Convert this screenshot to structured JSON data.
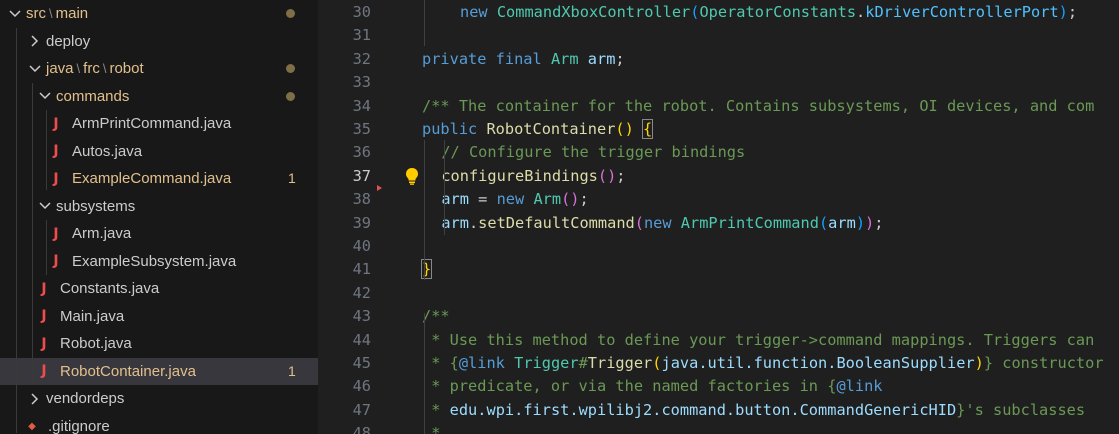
{
  "explorer": {
    "items": [
      {
        "label_parts": [
          "src",
          "main"
        ],
        "depth": 0,
        "chevron": "down",
        "status": "dot"
      },
      {
        "label": "deploy",
        "depth": 1,
        "chevron": "right"
      },
      {
        "label_parts": [
          "java",
          "frc",
          "robot"
        ],
        "depth": 1,
        "chevron": "down",
        "status": "dot"
      },
      {
        "label": "commands",
        "depth": 2,
        "chevron": "down",
        "status": "dot"
      },
      {
        "label": "ArmPrintCommand.java",
        "depth": 3,
        "icon": "java-file-icon"
      },
      {
        "label": "Autos.java",
        "depth": 3,
        "icon": "java-file-icon"
      },
      {
        "label": "ExampleCommand.java",
        "depth": 3,
        "icon": "java-file-icon",
        "badge": "1"
      },
      {
        "label": "subsystems",
        "depth": 2,
        "chevron": "down"
      },
      {
        "label": "Arm.java",
        "depth": 3,
        "icon": "java-file-icon"
      },
      {
        "label": "ExampleSubsystem.java",
        "depth": 3,
        "icon": "java-file-icon"
      },
      {
        "label": "Constants.java",
        "depth": 2,
        "icon": "java-file-icon"
      },
      {
        "label": "Main.java",
        "depth": 2,
        "icon": "java-file-icon"
      },
      {
        "label": "Robot.java",
        "depth": 2,
        "icon": "java-file-icon"
      },
      {
        "label": "RobotContainer.java",
        "depth": 2,
        "icon": "java-file-icon",
        "badge": "1",
        "selected": true
      },
      {
        "label": "vendordeps",
        "depth": 1,
        "chevron": "right"
      },
      {
        "label": ".gitignore",
        "depth": 1,
        "icon": "gitignore-icon"
      }
    ],
    "path_separator": "\\"
  },
  "editor": {
    "active_line": 37,
    "lines": [
      {
        "n": 30,
        "indent": 1,
        "tokens": [
          [
            "kw",
            "new "
          ],
          [
            "ty",
            "CommandXboxController"
          ],
          [
            "br3",
            "("
          ],
          [
            "ty",
            "OperatorConstants"
          ],
          [
            "p",
            "."
          ],
          [
            "cl",
            "kDriverControllerPort"
          ],
          [
            "br3",
            ")"
          ],
          [
            "p",
            ";"
          ]
        ]
      },
      {
        "n": 31,
        "indent": 0,
        "tokens": []
      },
      {
        "n": 32,
        "indent": 0,
        "tokens": [
          [
            "kw",
            "private final "
          ],
          [
            "ty",
            "Arm "
          ],
          [
            "va",
            "arm"
          ],
          [
            "p",
            ";"
          ]
        ]
      },
      {
        "n": 33,
        "indent": 0,
        "tokens": []
      },
      {
        "n": 34,
        "indent": 0,
        "tokens": [
          [
            "co",
            "/** The container for the robot. Contains subsystems, OI devices, and com"
          ]
        ]
      },
      {
        "n": 35,
        "indent": 0,
        "tokens": [
          [
            "kw",
            "public "
          ],
          [
            "fn",
            "RobotContainer"
          ],
          [
            "br1",
            "()"
          ],
          [
            "p",
            " "
          ],
          [
            "br1box",
            "{"
          ]
        ]
      },
      {
        "n": 36,
        "indent": 1,
        "tokens": [
          [
            "co",
            "// Configure the trigger bindings"
          ]
        ]
      },
      {
        "n": 37,
        "indent": 1,
        "tokens": [
          [
            "fn",
            "configureBindings"
          ],
          [
            "br2",
            "()"
          ],
          [
            "p",
            ";"
          ]
        ]
      },
      {
        "n": 38,
        "indent": 1,
        "tokens": [
          [
            "va",
            "arm"
          ],
          [
            "p",
            " = "
          ],
          [
            "kw",
            "new "
          ],
          [
            "ty",
            "Arm"
          ],
          [
            "br2",
            "()"
          ],
          [
            "p",
            ";"
          ]
        ]
      },
      {
        "n": 39,
        "indent": 1,
        "tokens": [
          [
            "va",
            "arm"
          ],
          [
            "p",
            "."
          ],
          [
            "fn",
            "setDefaultCommand"
          ],
          [
            "br2",
            "("
          ],
          [
            "kw",
            "new "
          ],
          [
            "ty",
            "ArmPrintCommand"
          ],
          [
            "br3",
            "("
          ],
          [
            "va",
            "arm"
          ],
          [
            "br3",
            ")"
          ],
          [
            "br2",
            ")"
          ],
          [
            "p",
            ";"
          ]
        ]
      },
      {
        "n": 40,
        "indent": 0,
        "tokens": []
      },
      {
        "n": 41,
        "indent": 0,
        "tokens": [
          [
            "br1box",
            "}"
          ]
        ]
      },
      {
        "n": 42,
        "indent": 0,
        "tokens": []
      },
      {
        "n": 43,
        "indent": 0,
        "tokens": [
          [
            "co",
            "/**"
          ]
        ]
      },
      {
        "n": 44,
        "indent": 0,
        "tokens": [
          [
            "co",
            " * Use this method to define your trigger->command mappings. Triggers can"
          ]
        ]
      },
      {
        "n": 45,
        "indent": 0,
        "tokens": [
          [
            "co",
            " * {"
          ],
          [
            "tg",
            "@link "
          ],
          [
            "ty",
            "Trigger"
          ],
          [
            "co",
            "#"
          ],
          [
            "fn",
            "Trigger"
          ],
          [
            "br1",
            "("
          ],
          [
            "va",
            "java.util.function.BooleanSupplier"
          ],
          [
            "br1",
            ")"
          ],
          [
            "co",
            "} constructor"
          ]
        ]
      },
      {
        "n": 46,
        "indent": 0,
        "tokens": [
          [
            "co",
            " * predicate, or via the named factories in {"
          ],
          [
            "tg",
            "@link"
          ]
        ]
      },
      {
        "n": 47,
        "indent": 0,
        "tokens": [
          [
            "co",
            " * "
          ],
          [
            "va",
            "edu.wpi.first.wpilibj2.command.button.CommandGenericHID"
          ],
          [
            "co",
            "}'s subclasses"
          ]
        ]
      },
      {
        "n": 48,
        "indent": 0,
        "tokens": [
          [
            "co",
            " * "
          ]
        ]
      }
    ]
  }
}
